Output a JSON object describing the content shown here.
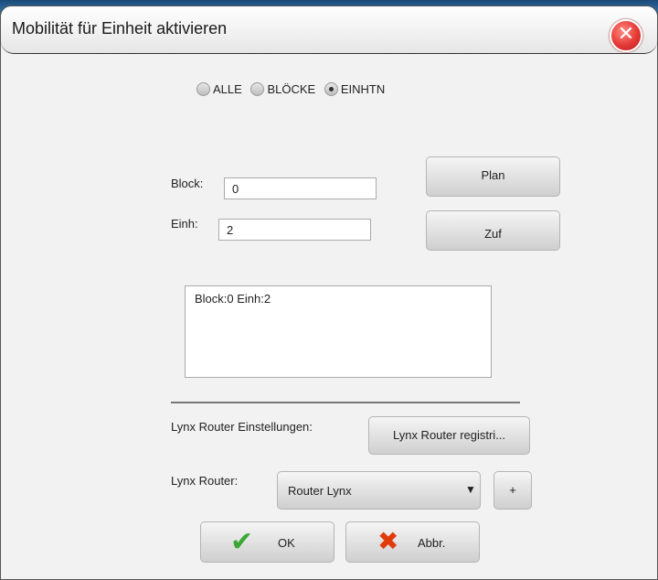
{
  "dialog": {
    "title": "Mobilität für Einheit aktivieren"
  },
  "filter": {
    "options": [
      {
        "label": "ALLE",
        "selected": false
      },
      {
        "label": "BLÖCKE",
        "selected": false
      },
      {
        "label": "EINHTN",
        "selected": true
      }
    ]
  },
  "form": {
    "block_label": "Block:",
    "block_value": "0",
    "unit_label": "Einh:",
    "unit_value": "2"
  },
  "buttons": {
    "plan": "Plan",
    "add": "Zuf",
    "lynx_register": "Lynx Router registri...",
    "plus": "+",
    "ok": "OK",
    "cancel": "Abbr."
  },
  "list": {
    "items": [
      "Block:0 Einh:2"
    ]
  },
  "lynx": {
    "settings_label": "Lynx Router Einstellungen:",
    "router_label": "Lynx Router:",
    "router_selected": "Router Lynx"
  },
  "icons": {
    "close": "close-icon",
    "ok": "checkmark-icon",
    "cancel": "red-x-icon",
    "dropdown": "triangle-down-icon"
  },
  "colors": {
    "close": "#e53935",
    "check": "#3aa835",
    "cross": "#e23b0c"
  }
}
